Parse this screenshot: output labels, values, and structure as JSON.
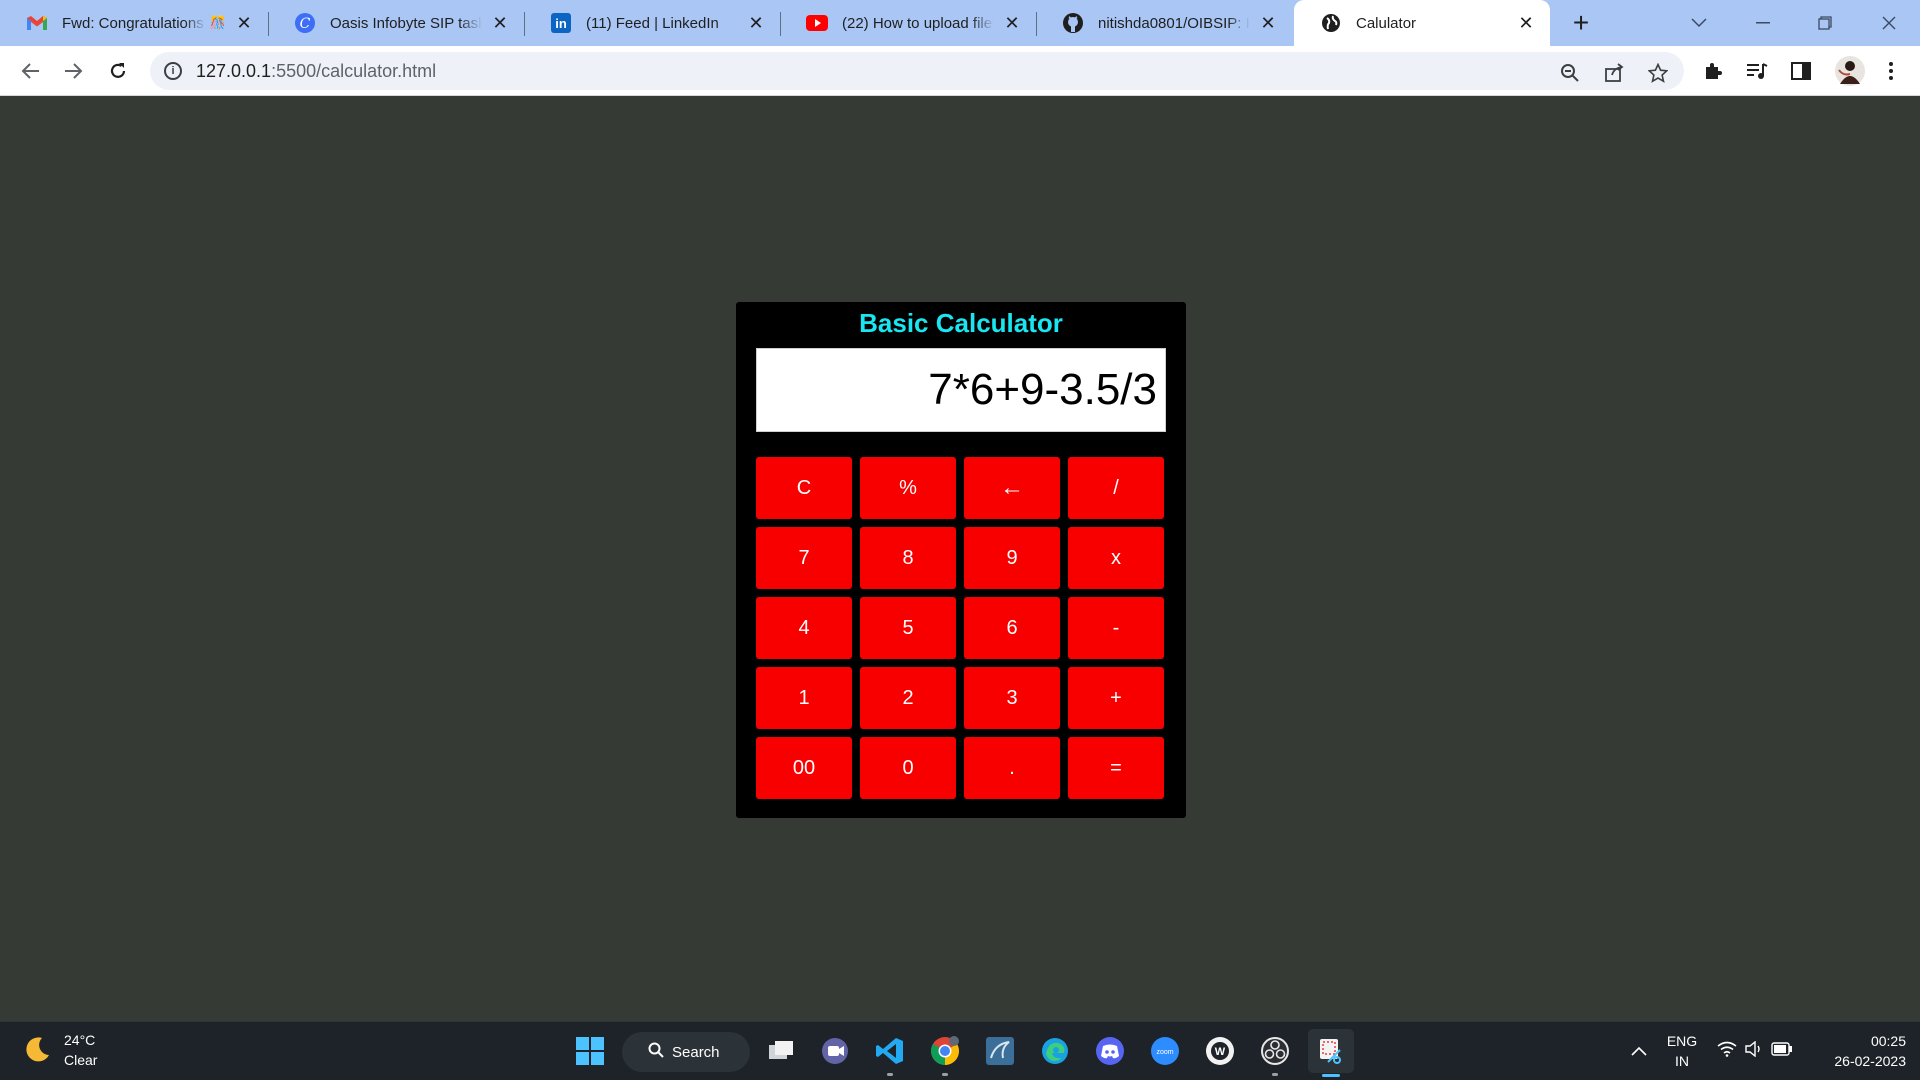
{
  "browser": {
    "tabs": [
      {
        "title": "Fwd: Congratulations",
        "icon": "gmail-icon",
        "active": false
      },
      {
        "title": "Oasis Infobyte SIP task lis",
        "icon": "canva-icon",
        "active": false
      },
      {
        "title": "(11) Feed | LinkedIn",
        "icon": "linkedin-icon",
        "active": false
      },
      {
        "title": "(22) How to upload files/",
        "icon": "youtube-icon",
        "active": false
      },
      {
        "title": "nitishda0801/OIBSIP: In t",
        "icon": "github-icon",
        "active": false
      },
      {
        "title": "Calulator",
        "icon": "globe-icon",
        "active": true
      }
    ],
    "address": {
      "host": "127.0.0.1",
      "rest": ":5500/calculator.html"
    }
  },
  "calculator": {
    "title": "Basic Calculator",
    "display": "7*6+9-3.5/3",
    "keys": [
      "C",
      "%",
      "←",
      "/",
      "7",
      "8",
      "9",
      "x",
      "4",
      "5",
      "6",
      "-",
      "1",
      "2",
      "3",
      "+",
      "00",
      "0",
      ".",
      "="
    ],
    "accent_color": "#f80000",
    "title_color": "#19e6f0"
  },
  "taskbar": {
    "weather": {
      "temp": "24°C",
      "condition": "Clear"
    },
    "search_label": "Search",
    "language": {
      "line1": "ENG",
      "line2": "IN"
    },
    "clock": {
      "time": "00:25",
      "date": "26-02-2023"
    }
  }
}
